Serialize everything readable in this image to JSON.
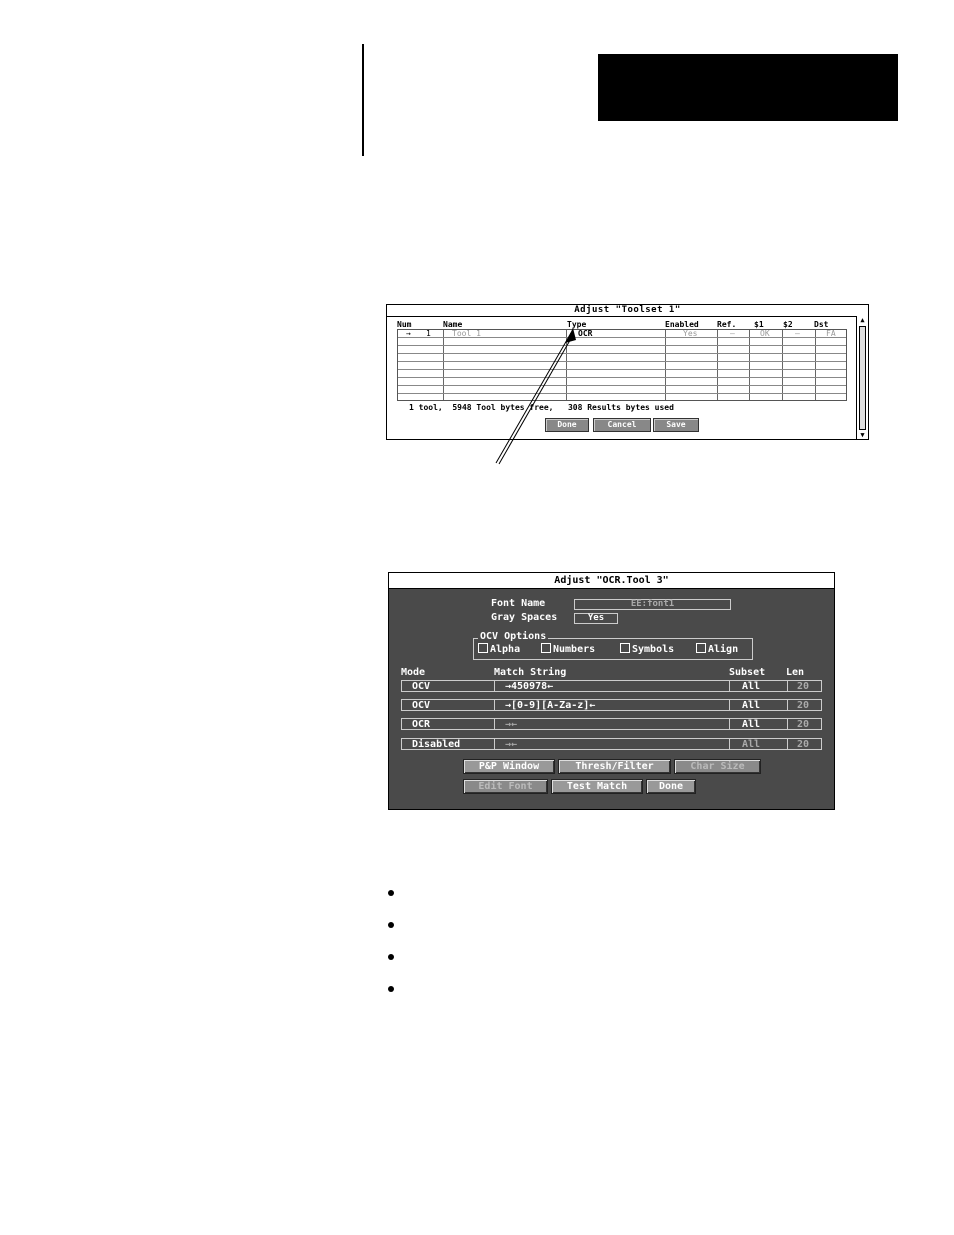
{
  "dialog1": {
    "title": "Adjust \"Toolset 1\"",
    "headers": [
      "Num",
      "Name",
      "Type",
      "Enabled",
      "Ref.",
      "$1",
      "$2",
      "Dst"
    ],
    "rows": [
      {
        "arrow": "→",
        "num": "1",
        "name": "Tool 1",
        "type": "OCR",
        "enabled": "Yes",
        "ref": "—",
        "s1": "OK",
        "s2": "—",
        "dst": "FA"
      }
    ],
    "status": "1 tool,  5948 Tool bytes free,   308 Results bytes used",
    "buttons": {
      "done": "Done",
      "cancel": "Cancel",
      "save": "Save"
    }
  },
  "dialog2": {
    "title": "Adjust \"OCR.Tool 3\"",
    "font_name_label": "Font Name",
    "font_name_value": "EE:font1",
    "gray_spaces_label": "Gray Spaces",
    "gray_spaces_value": "Yes",
    "ocv_options": {
      "legend": "OCV Options",
      "alpha": "Alpha",
      "numbers": "Numbers",
      "symbols": "Symbols",
      "align": "Align"
    },
    "headers": {
      "mode": "Mode",
      "match": "Match String",
      "subset": "Subset",
      "len": "Len"
    },
    "rows": [
      {
        "mode": "OCV",
        "match": "→450978←",
        "subset": "All",
        "len": "20"
      },
      {
        "mode": "OCV",
        "match": "→[0-9][A-Za-z]←",
        "subset": "All",
        "len": "20"
      },
      {
        "mode": "OCR",
        "match": "→←",
        "subset": "All",
        "len": "20"
      },
      {
        "mode": "Disabled",
        "match": "→←",
        "subset": "All",
        "len": "20"
      }
    ],
    "buttons": {
      "pp_window": "P&P Window",
      "thresh_filter": "Thresh/Filter",
      "char_size": "Char Size",
      "edit_font": "Edit Font",
      "test_match": "Test Match",
      "done": "Done"
    }
  }
}
